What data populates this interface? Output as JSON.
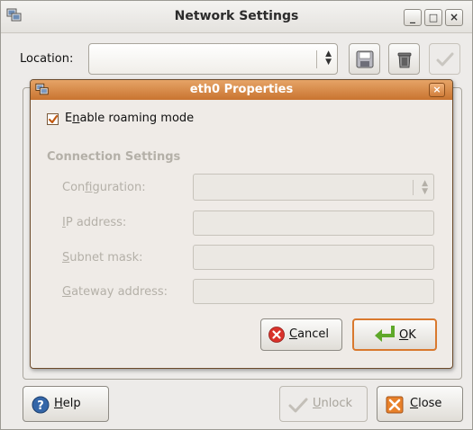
{
  "window": {
    "title": "Network Settings",
    "buttons": {
      "minimize": "_",
      "maximize": "□",
      "close": "×"
    }
  },
  "location": {
    "label": "Location:",
    "value": ""
  },
  "footer": {
    "help": {
      "mnemonic": "H",
      "rest": "elp"
    },
    "unlock": {
      "mnemonic": "U",
      "rest": "nlock"
    },
    "close": {
      "mnemonic": "C",
      "rest": "lose"
    }
  },
  "dialog": {
    "title": "eth0 Properties",
    "close_glyph": "×",
    "roaming": {
      "prefix": "E",
      "mnemonic": "n",
      "rest": "able roaming mode",
      "checked": true
    },
    "section_title": "Connection Settings",
    "fields": {
      "configuration": {
        "prefix": "Con",
        "mnemonic": "f",
        "rest": "iguration:"
      },
      "ip": {
        "mnemonic": "I",
        "rest": "P address:"
      },
      "subnet": {
        "mnemonic": "S",
        "rest": "ubnet mask:"
      },
      "gateway": {
        "mnemonic": "G",
        "rest": "ateway address:"
      }
    },
    "buttons": {
      "cancel": {
        "mnemonic": "C",
        "rest": "ancel"
      },
      "ok": {
        "mnemonic": "O",
        "rest": "K"
      }
    }
  },
  "colors": {
    "dialog_titlebar": "#c97430",
    "ok_border": "#d9792e",
    "disabled_text": "#b4b0a8"
  }
}
